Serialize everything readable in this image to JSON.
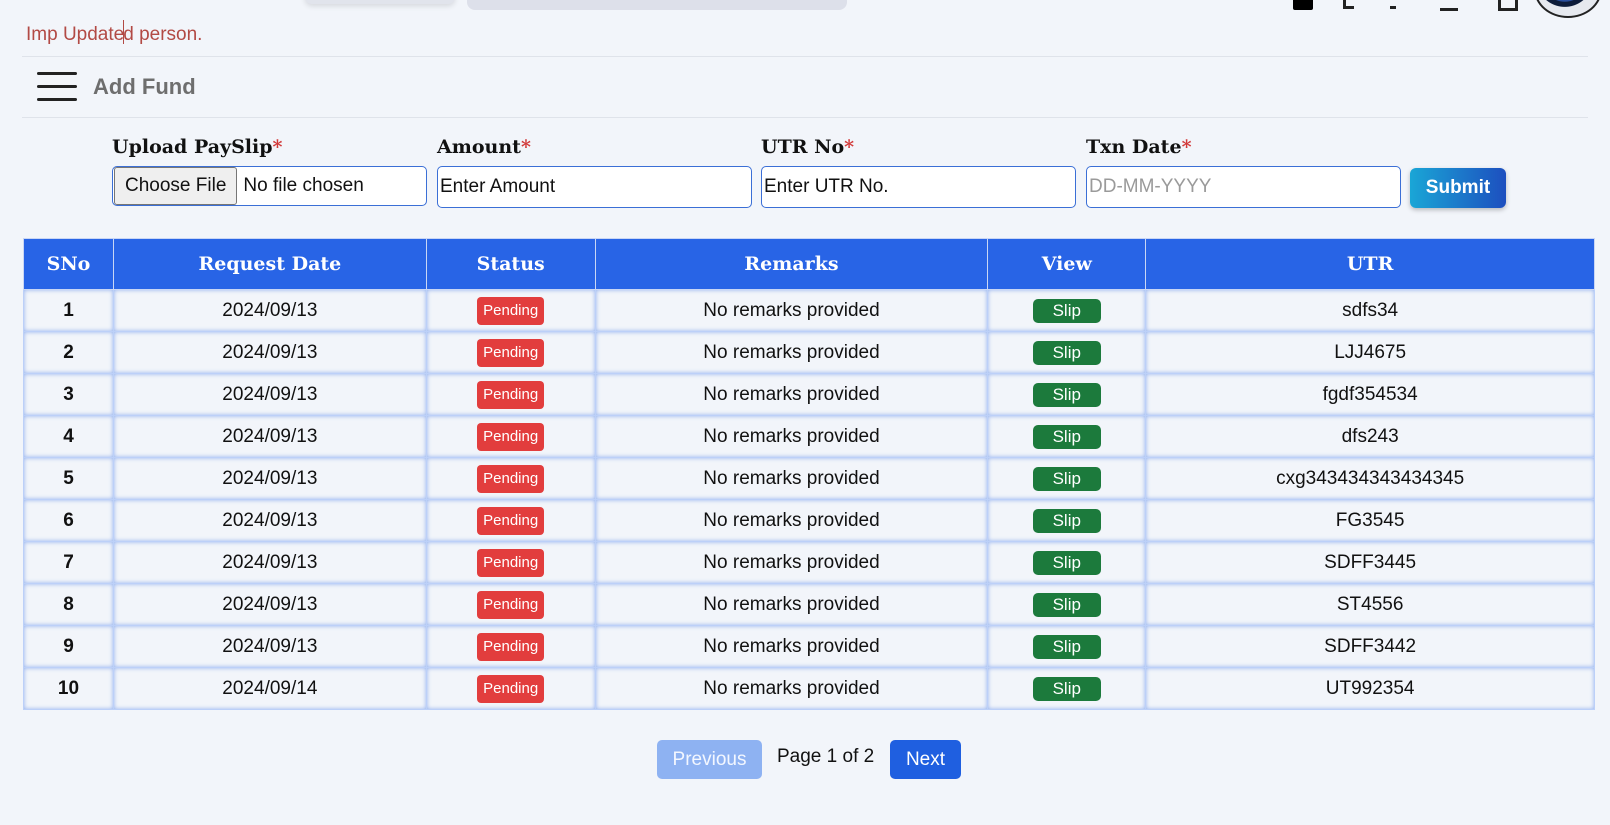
{
  "marquee": {
    "before_caret": "Imp Update",
    "after_caret": "d person."
  },
  "header": {
    "title": "Add Fund"
  },
  "form": {
    "upload": {
      "label": "Upload PaySlip",
      "required_mark": "*",
      "button": "Choose File",
      "file_status": "No file chosen"
    },
    "amount": {
      "label": "Amount",
      "required_mark": "*",
      "placeholder": "Enter Amount"
    },
    "utr": {
      "label": "UTR No",
      "required_mark": "*",
      "placeholder": "Enter UTR No."
    },
    "txn_date": {
      "label": "Txn Date",
      "required_mark": "*",
      "placeholder": "DD-MM-YYYY"
    },
    "submit": "Submit"
  },
  "table": {
    "columns": [
      "SNo",
      "Request Date",
      "Status",
      "Remarks",
      "View",
      "UTR"
    ],
    "rows": [
      {
        "sno": "1",
        "date": "2024/09/13",
        "status": "Pending",
        "remarks": "No remarks provided",
        "view": "Slip",
        "utr": "sdfs34"
      },
      {
        "sno": "2",
        "date": "2024/09/13",
        "status": "Pending",
        "remarks": "No remarks provided",
        "view": "Slip",
        "utr": "LJJ4675"
      },
      {
        "sno": "3",
        "date": "2024/09/13",
        "status": "Pending",
        "remarks": "No remarks provided",
        "view": "Slip",
        "utr": "fgdf354534"
      },
      {
        "sno": "4",
        "date": "2024/09/13",
        "status": "Pending",
        "remarks": "No remarks provided",
        "view": "Slip",
        "utr": "dfs243"
      },
      {
        "sno": "5",
        "date": "2024/09/13",
        "status": "Pending",
        "remarks": "No remarks provided",
        "view": "Slip",
        "utr": "cxg343434343434345"
      },
      {
        "sno": "6",
        "date": "2024/09/13",
        "status": "Pending",
        "remarks": "No remarks provided",
        "view": "Slip",
        "utr": "FG3545"
      },
      {
        "sno": "7",
        "date": "2024/09/13",
        "status": "Pending",
        "remarks": "No remarks provided",
        "view": "Slip",
        "utr": "SDFF3445"
      },
      {
        "sno": "8",
        "date": "2024/09/13",
        "status": "Pending",
        "remarks": "No remarks provided",
        "view": "Slip",
        "utr": "ST4556"
      },
      {
        "sno": "9",
        "date": "2024/09/13",
        "status": "Pending",
        "remarks": "No remarks provided",
        "view": "Slip",
        "utr": "SDFF3442"
      },
      {
        "sno": "10",
        "date": "2024/09/14",
        "status": "Pending",
        "remarks": "No remarks provided",
        "view": "Slip",
        "utr": "UT992354"
      }
    ]
  },
  "pagination": {
    "previous": "Previous",
    "info": "Page 1 of 2",
    "next": "Next"
  },
  "colors": {
    "header_bg": "#2864e6",
    "pending": "#e23d3d",
    "slip": "#1c7a3c",
    "next": "#1f5fe0",
    "prev_disabled": "#8eb2f2"
  }
}
